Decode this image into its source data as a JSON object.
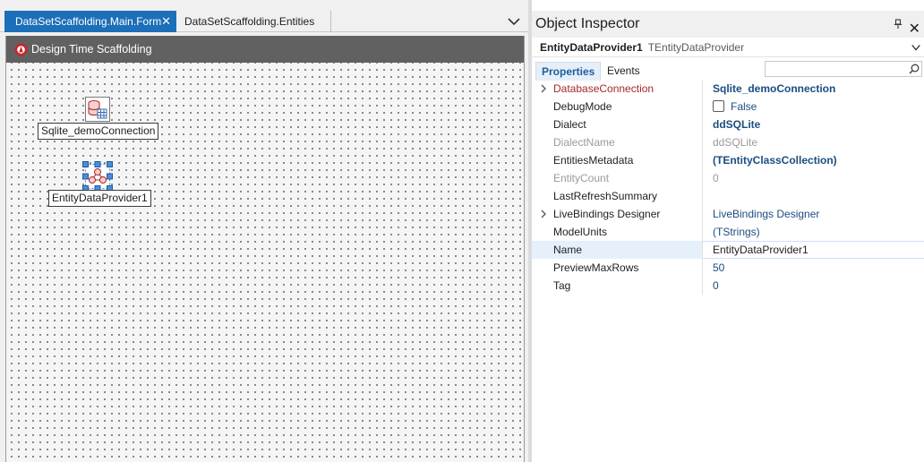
{
  "designer": {
    "tabs": [
      {
        "label": "DataSetScaffolding.Main.Form",
        "active": true
      },
      {
        "label": "DataSetScaffolding.Entities",
        "active": false
      }
    ],
    "form_caption": "Design Time Scaffolding",
    "components": [
      {
        "label": "Sqlite_demoConnection",
        "icon": "database-connection-icon"
      },
      {
        "label": "EntityDataProvider1",
        "icon": "entity-provider-icon",
        "selected": true
      }
    ]
  },
  "inspector": {
    "title": "Object Inspector",
    "selected_object": {
      "name": "EntityDataProvider1",
      "class": "TEntityDataProvider"
    },
    "tabs": [
      "Properties",
      "Events"
    ],
    "search_placeholder": "",
    "properties": [
      {
        "name": "DatabaseConnection",
        "value": "Sqlite_demoConnection",
        "expandable": true
      },
      {
        "name": "DebugMode",
        "value": "False",
        "checkbox": true
      },
      {
        "name": "Dialect",
        "value": "ddSQLite"
      },
      {
        "name": "DialectName",
        "value": "ddSQLite"
      },
      {
        "name": "EntitiesMetadata",
        "value": "(TEntityClassCollection)"
      },
      {
        "name": "EntityCount",
        "value": "0"
      },
      {
        "name": "LastRefreshSummary",
        "value": ""
      },
      {
        "name": "LiveBindings Designer",
        "value": "LiveBindings Designer",
        "expandable": true
      },
      {
        "name": "ModelUnits",
        "value": "(TStrings)"
      },
      {
        "name": "Name",
        "value": "EntityDataProvider1",
        "selected": true
      },
      {
        "name": "PreviewMaxRows",
        "value": "50"
      },
      {
        "name": "Tag",
        "value": "0"
      }
    ]
  },
  "colors": {
    "active_tab": "#1c6fb8",
    "form_caption": "#616161",
    "value_blue": "#1a4d80",
    "name_red": "#a52a2a"
  }
}
